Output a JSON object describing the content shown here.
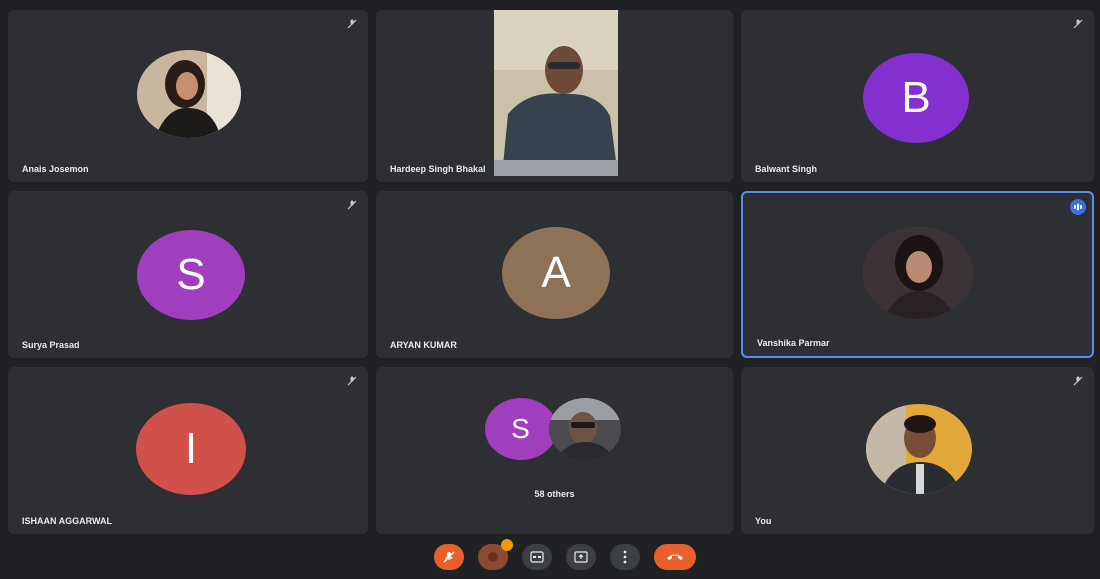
{
  "tiles": [
    {
      "name": "Anais Josemon",
      "muted": true,
      "type": "photo-avatar"
    },
    {
      "name": "Hardeep Singh Bhakal",
      "muted": false,
      "type": "video"
    },
    {
      "name": "Balwant Singh",
      "muted": true,
      "type": "letter-avatar",
      "letter": "B",
      "color": "#8430ce"
    },
    {
      "name": "Surya Prasad",
      "muted": true,
      "type": "letter-avatar",
      "letter": "S",
      "color": "#a13ebd"
    },
    {
      "name": "ARYAN KUMAR",
      "muted": false,
      "type": "letter-avatar",
      "letter": "A",
      "color": "#8d7258"
    },
    {
      "name": "Vanshika Parmar",
      "muted": false,
      "speaking": true,
      "type": "photo-avatar"
    },
    {
      "name": "ISHAAN AGGARWAL",
      "muted": true,
      "type": "letter-avatar",
      "letter": "I",
      "color": "#d1504a"
    },
    {
      "name": "",
      "muted": false,
      "type": "others",
      "letter": "S",
      "label": "58 others"
    },
    {
      "name": "You",
      "muted": true,
      "type": "photo-avatar"
    }
  ],
  "toolbar": {
    "buttons": [
      {
        "icon": "mic-off-icon",
        "color": "#e8612c"
      },
      {
        "icon": "camera-off-icon",
        "color": "#8b4a33",
        "badge": true
      },
      {
        "icon": "captions-icon",
        "color": "#3c4043"
      },
      {
        "icon": "present-screen-icon",
        "color": "#3c4043"
      },
      {
        "icon": "more-options-icon",
        "color": "#3c4043"
      },
      {
        "icon": "end-call-icon",
        "color": "#e8612c"
      }
    ]
  }
}
